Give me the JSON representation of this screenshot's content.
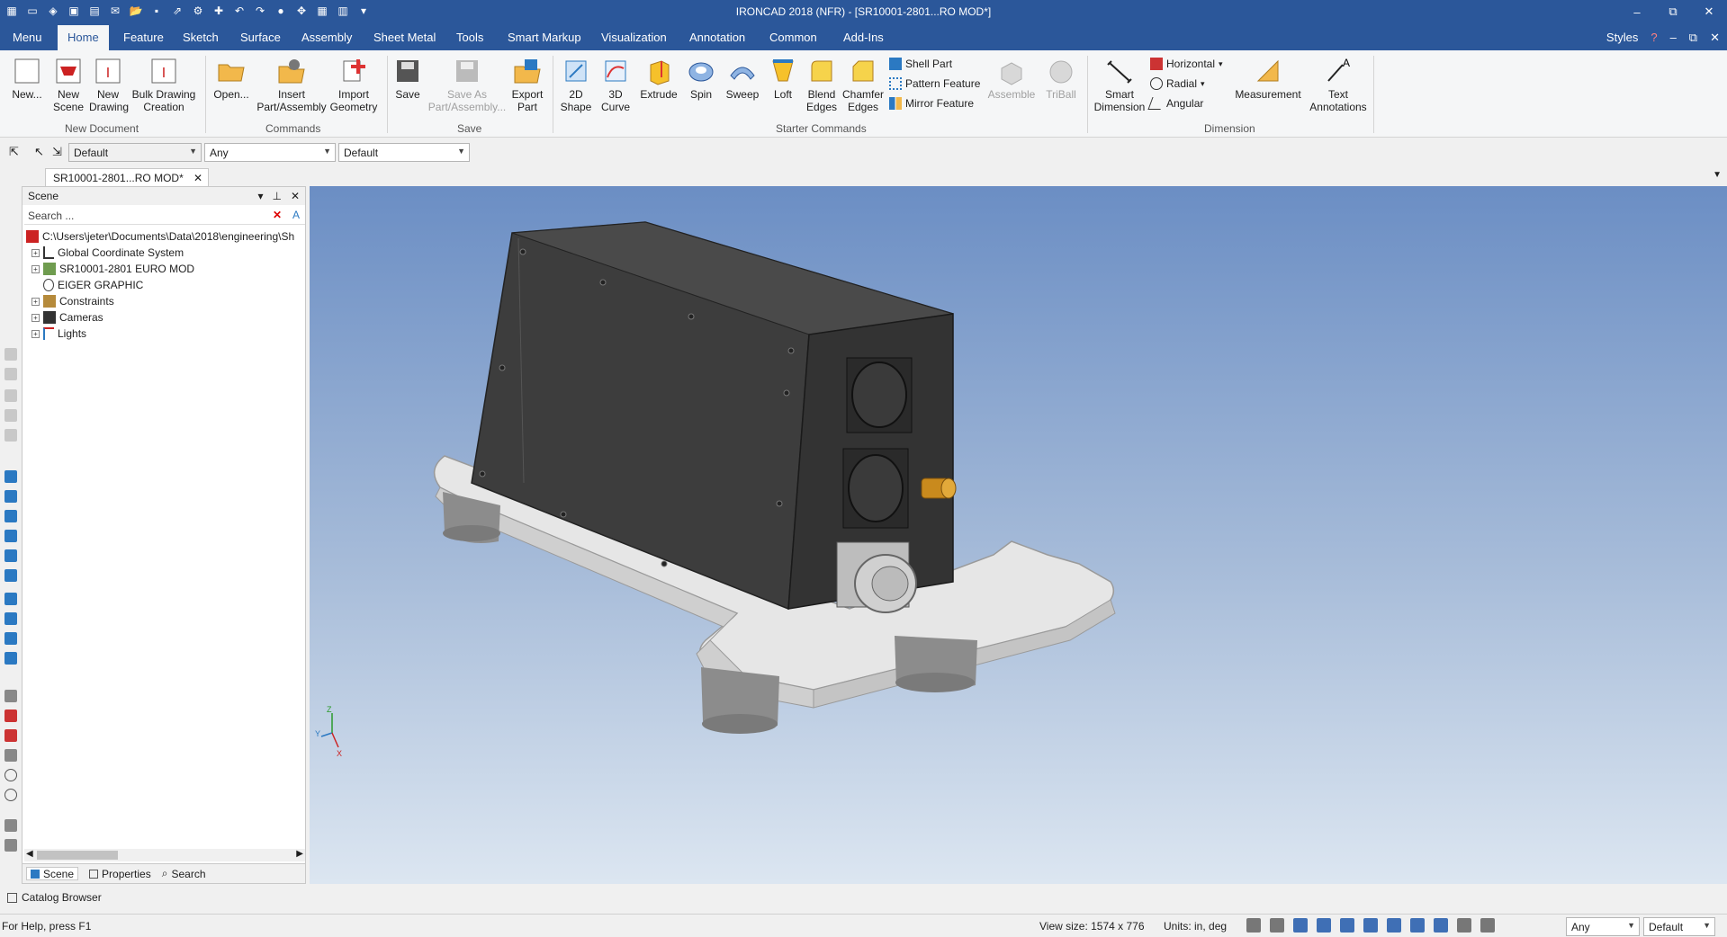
{
  "app": {
    "title": "IRONCAD 2018 (NFR) - [SR10001-2801...RO MOD*]",
    "window_controls": [
      "–",
      "⧉",
      "✕"
    ]
  },
  "quick_access_icons": [
    "app-icon",
    "new-icon",
    "new-scene-icon",
    "new-drawing-icon",
    "bulk-icon",
    "email-icon",
    "open-icon",
    "save-icon",
    "export-icon",
    "insert-icon",
    "import-icon",
    "undo-icon",
    "redo-icon",
    "triball-icon",
    "scene-icon",
    "table-icon",
    "layout-icon",
    "more-icon"
  ],
  "tabs": [
    "Menu",
    "Home",
    "Feature",
    "Sketch",
    "Surface",
    "Assembly",
    "Sheet Metal",
    "Tools",
    "Smart Markup",
    "Visualization",
    "Annotation",
    "Common",
    "Add-Ins"
  ],
  "active_tab": "Home",
  "styles_label": "Styles",
  "ribbon": {
    "new_document": {
      "label": "New Document",
      "buttons": [
        {
          "label": "New..."
        },
        {
          "label": "New\nScene"
        },
        {
          "label": "New\nDrawing"
        },
        {
          "label": "Bulk Drawing\nCreation"
        }
      ]
    },
    "commands": {
      "label": "Commands",
      "buttons": [
        {
          "label": "Open..."
        },
        {
          "label": "Insert\nPart/Assembly"
        },
        {
          "label": "Import\nGeometry"
        }
      ]
    },
    "save": {
      "label": "Save",
      "buttons": [
        {
          "label": "Save"
        },
        {
          "label": "Save As\nPart/Assembly..."
        },
        {
          "label": "Export\nPart"
        }
      ]
    },
    "starter": {
      "label": "Starter Commands",
      "buttons": [
        {
          "label": "2D\nShape"
        },
        {
          "label": "3D\nCurve"
        },
        {
          "label": "Extrude"
        },
        {
          "label": "Spin"
        },
        {
          "label": "Sweep"
        },
        {
          "label": "Loft"
        },
        {
          "label": "Blend\nEdges"
        },
        {
          "label": "Chamfer\nEdges"
        }
      ],
      "small": [
        "Shell Part",
        "Pattern Feature",
        "Mirror Feature"
      ],
      "disabled": [
        "Assemble",
        "TriBall"
      ]
    },
    "dimension": {
      "label": "Dimension",
      "small": [
        "Horizontal",
        "Radial",
        "Angular"
      ],
      "buttons": [
        {
          "label": "Smart\nDimension"
        },
        {
          "label": "Measurement"
        },
        {
          "label": "Text\nAnnotations"
        }
      ]
    }
  },
  "propbar": {
    "style_combo": "Default",
    "filter_combo": "Any",
    "material_combo": "Default"
  },
  "document_tab": {
    "label": "SR10001-2801...RO MOD*"
  },
  "scene_panel": {
    "title": "Scene",
    "search_placeholder": "Search ...",
    "tree": [
      {
        "label": "C:\\Users\\jeter\\Documents\\Data\\2018\\engineering\\Sh",
        "icon": "scene-root-icon",
        "expander": false
      },
      {
        "label": "Global Coordinate System",
        "icon": "coordinate-system-icon",
        "expander": true
      },
      {
        "label": "SR10001-2801 EURO MOD",
        "icon": "assembly-icon",
        "expander": true
      },
      {
        "label": "EIGER GRAPHIC",
        "icon": "graphic-icon",
        "expander": false
      },
      {
        "label": "Constraints",
        "icon": "constraints-icon",
        "expander": true
      },
      {
        "label": "Cameras",
        "icon": "camera-icon",
        "expander": true
      },
      {
        "label": "Lights",
        "icon": "lights-icon",
        "expander": true
      }
    ],
    "bottom_tabs": [
      "Scene",
      "Properties",
      "Search"
    ]
  },
  "catalog_label": "Catalog Browser",
  "status": {
    "help": "For Help, press F1",
    "view_size": "View size: 1574 x  776",
    "units": "Units: in, deg",
    "filter": "Any",
    "style": "Default"
  },
  "colors": {
    "title_bar": "#2b579a",
    "accent": "#2b579a",
    "viewport_top": "#6b8ec4",
    "viewport_bottom": "#dce6f1"
  }
}
